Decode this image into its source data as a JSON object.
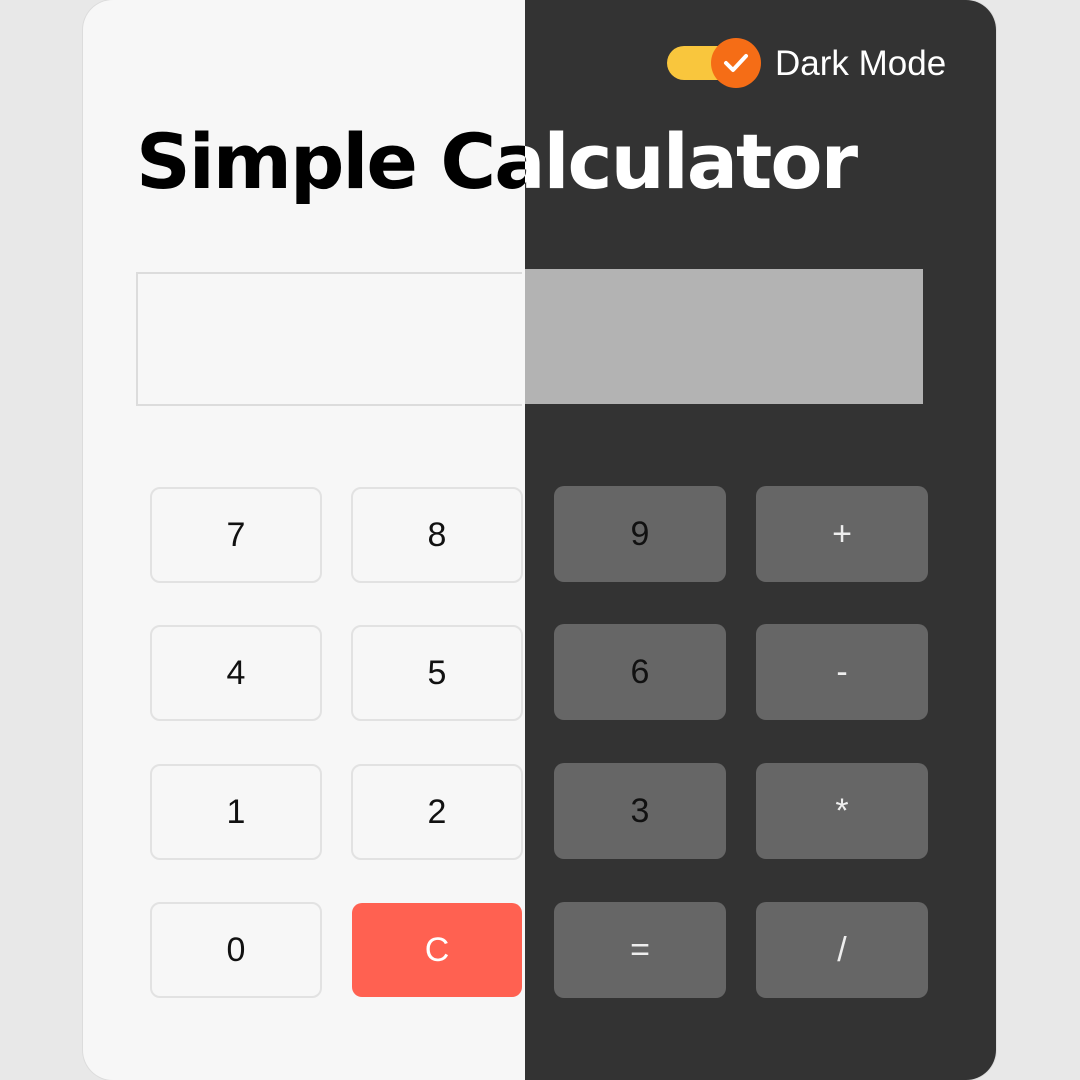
{
  "app": {
    "title": "Simple Calculator"
  },
  "theme_toggle": {
    "label": "Dark Mode",
    "checked": true
  },
  "display": {
    "value": ""
  },
  "keys": {
    "k7": "7",
    "k8": "8",
    "k9": "9",
    "kadd": "+",
    "k4": "4",
    "k5": "5",
    "k6": "6",
    "ksub": "-",
    "k1": "1",
    "k2": "2",
    "k3": "3",
    "kmul": "*",
    "k0": "0",
    "kclear": "C",
    "keq": "=",
    "kdiv": "/"
  },
  "colors": {
    "light_background": "#f7f7f7",
    "dark_background": "#333333",
    "dark_key": "#666666",
    "dark_display": "#b3b3b3",
    "clear_key": "#ff6151",
    "toggle_track": "#f9c63d",
    "toggle_knob": "#f56d16"
  }
}
